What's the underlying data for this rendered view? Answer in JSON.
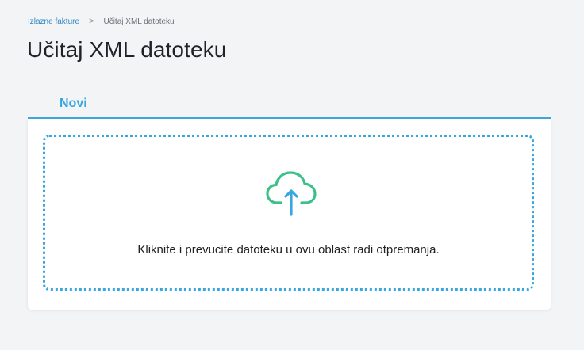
{
  "breadcrumb": {
    "parent": "Izlazne fakture",
    "separator": ">",
    "current": "Učitaj XML datoteku"
  },
  "page": {
    "title": "Učitaj XML datoteku"
  },
  "tabs": [
    {
      "label": "Novi",
      "active": true
    }
  ],
  "dropzone": {
    "icon": "cloud-upload-icon",
    "instruction": "Kliknite i prevucite datoteku u ovu oblast radi otpremanja."
  },
  "colors": {
    "accent": "#37a6de",
    "cloud": "#3cc08a",
    "arrow": "#3aa6e0",
    "background": "#f3f4f6"
  }
}
